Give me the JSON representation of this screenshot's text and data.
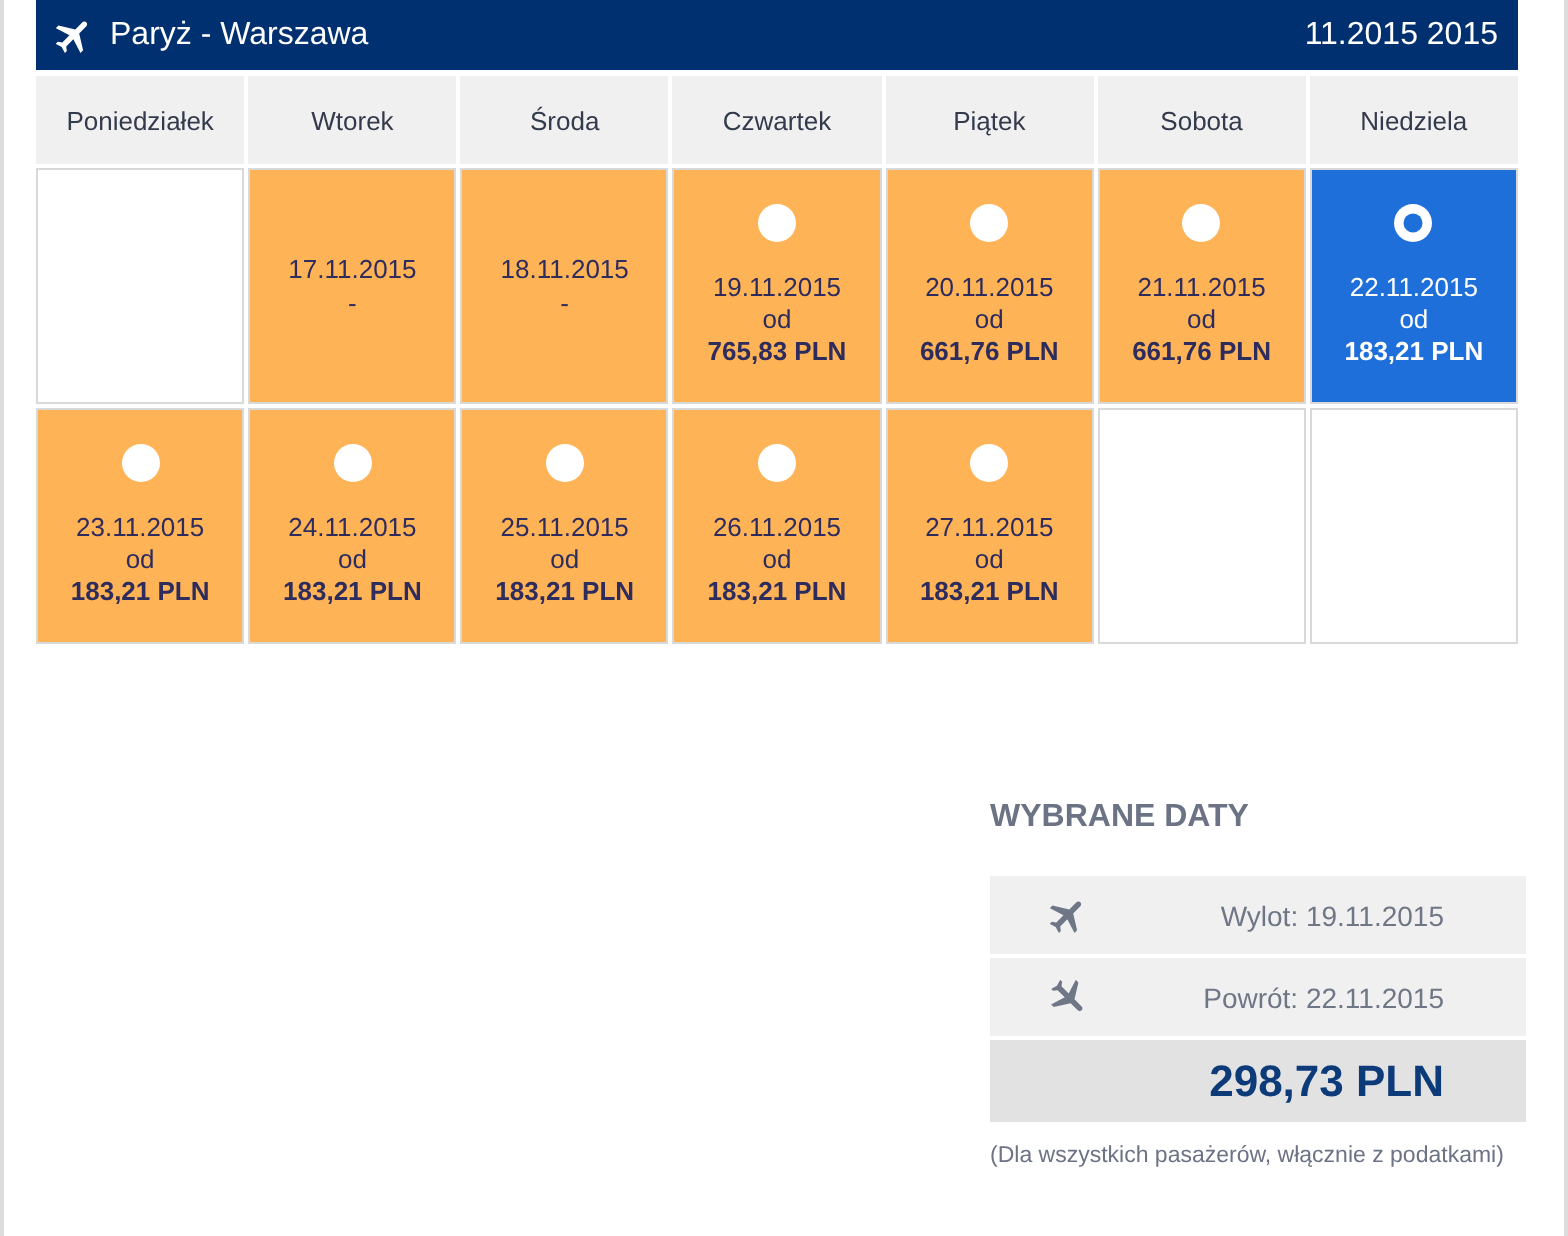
{
  "header": {
    "route": "Paryż - Warszawa",
    "month": "11.2015 2015"
  },
  "weekdays": [
    "Poniedziałek",
    "Wtorek",
    "Środa",
    "Czwartek",
    "Piątek",
    "Sobota",
    "Niedziela"
  ],
  "weeks": [
    [
      {
        "kind": "empty"
      },
      {
        "kind": "unavailable",
        "date": "17.11.2015",
        "note": "-",
        "selected": false
      },
      {
        "kind": "unavailable",
        "date": "18.11.2015",
        "note": "-",
        "selected": false
      },
      {
        "kind": "available",
        "date": "19.11.2015",
        "from_label": "od",
        "price": "765,83 PLN",
        "selected": false
      },
      {
        "kind": "available",
        "date": "20.11.2015",
        "from_label": "od",
        "price": "661,76 PLN",
        "selected": false
      },
      {
        "kind": "available",
        "date": "21.11.2015",
        "from_label": "od",
        "price": "661,76 PLN",
        "selected": false
      },
      {
        "kind": "available",
        "date": "22.11.2015",
        "from_label": "od",
        "price": "183,21 PLN",
        "selected": true
      }
    ],
    [
      {
        "kind": "available",
        "date": "23.11.2015",
        "from_label": "od",
        "price": "183,21 PLN",
        "selected": false
      },
      {
        "kind": "available",
        "date": "24.11.2015",
        "from_label": "od",
        "price": "183,21 PLN",
        "selected": false
      },
      {
        "kind": "available",
        "date": "25.11.2015",
        "from_label": "od",
        "price": "183,21 PLN",
        "selected": false
      },
      {
        "kind": "available",
        "date": "26.11.2015",
        "from_label": "od",
        "price": "183,21 PLN",
        "selected": false
      },
      {
        "kind": "available",
        "date": "27.11.2015",
        "from_label": "od",
        "price": "183,21 PLN",
        "selected": false
      },
      {
        "kind": "empty"
      },
      {
        "kind": "empty"
      }
    ]
  ],
  "summary": {
    "title": "WYBRANE DATY",
    "legs": [
      {
        "kind": "departure",
        "label": "Wylot: 19.11.2015"
      },
      {
        "kind": "return",
        "label": "Powrót: 22.11.2015"
      }
    ],
    "total": "298,73 PLN",
    "note": "(Dla wszystkich pasażerów, włącznie z podatkami)"
  }
}
